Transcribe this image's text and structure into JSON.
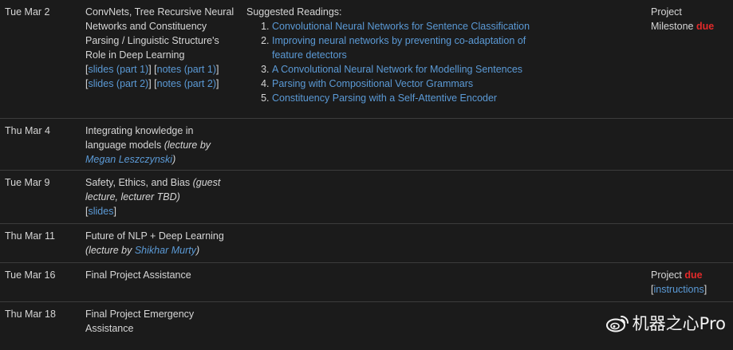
{
  "rows": [
    {
      "date": "Tue Mar 2",
      "desc_lines": [
        "ConvNets, Tree Recursive Neural",
        "Networks and Constituency",
        "Parsing / Linguistic Structure's",
        "Role in Deep Learning"
      ],
      "links": {
        "slides1": "slides (part 1)",
        "notes1": "notes (part 1)",
        "slides2": "slides (part 2)",
        "notes2": "notes (part 2)"
      },
      "readings_title": "Suggested Readings:",
      "readings": [
        [
          "Convolutional Neural Networks for Sentence Classification"
        ],
        [
          "Improving neural networks by preventing co-adaptation of",
          "feature detectors"
        ],
        [
          "A Convolutional Neural Network for Modelling Sentences"
        ],
        [
          "Parsing with Compositional Vector Grammars"
        ],
        [
          "Constituency Parsing with a Self-Attentive Encoder"
        ]
      ],
      "logistics": {
        "line1": "Project",
        "line2": "Milestone",
        "due": "due"
      }
    },
    {
      "date": "Thu Mar 4",
      "desc_lines": [
        "Integrating knowledge in",
        "language models"
      ],
      "paren_open": "(lecture by",
      "person": "Megan Leszczynski",
      "paren_close": ")"
    },
    {
      "date": "Tue Mar 9",
      "desc_line1": "Safety, Ethics, and Bias",
      "desc_italic1": "(guest",
      "desc_italic2": "lecture, lecturer TBD)",
      "slides": "slides"
    },
    {
      "date": "Thu Mar 11",
      "desc_line1": "Future of NLP + Deep Learning",
      "paren_open": "(lecture by",
      "person": "Shikhar Murty",
      "paren_close": ")"
    },
    {
      "date": "Tue Mar 16",
      "desc_line1": "Final Project Assistance",
      "logistics": {
        "line1": "Project",
        "due": "due",
        "link": "instructions"
      }
    },
    {
      "date": "Thu Mar 18",
      "desc_lines": [
        "Final Project Emergency",
        "Assistance"
      ]
    }
  ],
  "watermark": {
    "text": "机器之心Pro",
    "icon": "weibo-icon"
  }
}
